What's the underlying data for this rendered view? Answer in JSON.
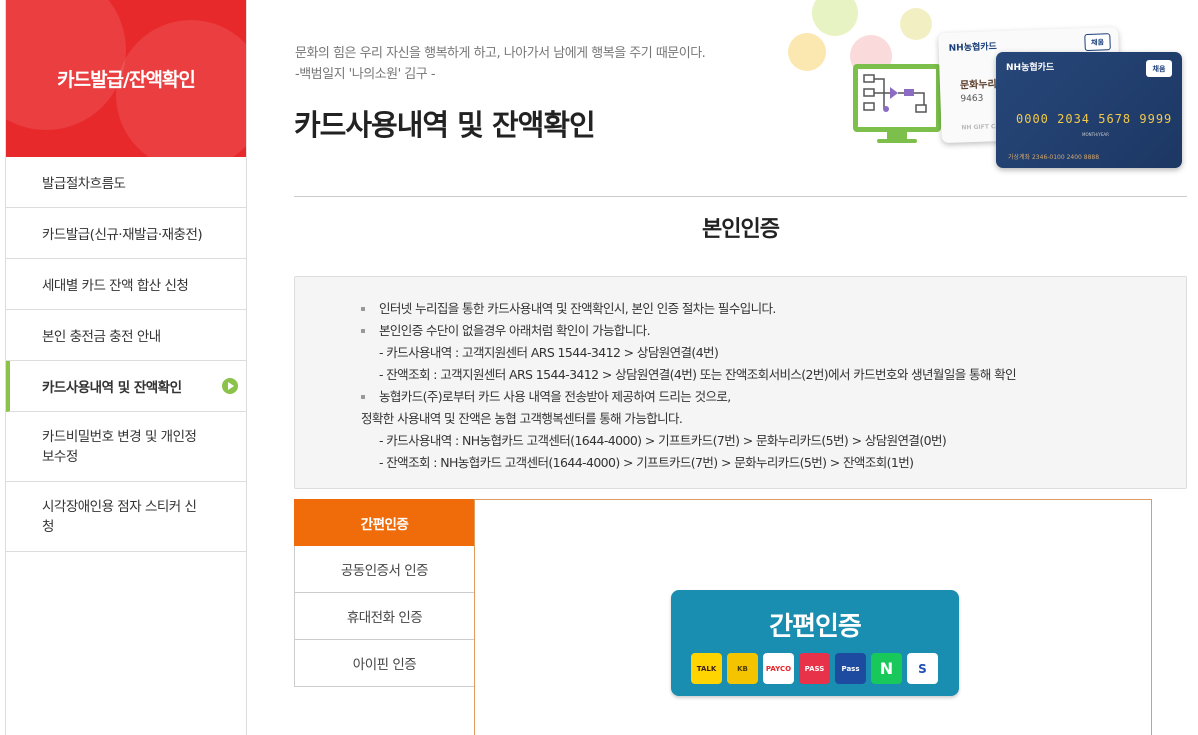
{
  "sidebar": {
    "title": "카드발급/잔액확인",
    "items": [
      {
        "label": "발급절차흐름도"
      },
      {
        "label": "카드발급(신규·재발급·재충전)"
      },
      {
        "label": "세대별 카드 잔액 합산 신청"
      },
      {
        "label": "본인 충전금 충전 안내"
      },
      {
        "label": "카드사용내역 및 잔액확인"
      },
      {
        "label": "카드비밀번호 변경 및 개인정보수정"
      },
      {
        "label": "시각장애인용 점자 스티커 신청"
      }
    ]
  },
  "header": {
    "quote_line1": "문화의 힘은 우리 자신을 행복하게 하고, 나아가서 남에게 행복을 주기 때문이다.",
    "quote_line2": "-백범일지 '나의소원' 김구 -",
    "title": "카드사용내역 및 잔액확인"
  },
  "illustration": {
    "card1_brand": "NH농협카드",
    "card1_badge": "채움",
    "card1_name": "문화누리",
    "card1_num": "9463",
    "card1_bottom": "NH GIFT CA",
    "card2_brand": "NH농협카드",
    "card2_badge": "채움",
    "card2_number": "0000 2034 5678 9999",
    "card2_expiry": "MONTH/YEAR",
    "card2_bottom": "가상계좌  2346-0100 2400 8888"
  },
  "section": {
    "title": "본인인증",
    "info": {
      "b1": "인터넷 누리집을 통한 카드사용내역 및 잔액확인시, 본인 인증 절차는 필수입니다.",
      "b2": "본인인증 수단이 없을경우 아래처럼 확인이 가능합니다.",
      "b2_s1": "- 카드사용내역 : 고객지원센터 ARS 1544-3412 > 상담원연결(4번)",
      "b2_s2": "- 잔액조회 : 고객지원센터 ARS 1544-3412 > 상담원연결(4번) 또는 잔액조회서비스(2번)에서 카드번호와 생년월일을 통해 확인",
      "b3": "농협카드(주)로부터 카드 사용 내역을 전송받아 제공하여 드리는 것으로,",
      "b3_l2": "정확한 사용내역 및 잔액은 농협 고객행복센터를 통해 가능합니다.",
      "b3_s1": "- 카드사용내역 : NH농협카드 고객센터(1644-4000) > 기프트카드(7번) > 문화누리카드(5번) > 상담원연결(0번)",
      "b3_s2": "- 잔액조회 : NH농협카드 고객센터(1644-4000) > 기프트카드(7번) > 문화누리카드(5번) > 잔액조회(1번)"
    }
  },
  "auth": {
    "tabs": [
      {
        "label": "간편인증"
      },
      {
        "label": "공동인증서 인증"
      },
      {
        "label": "휴대전화 인증"
      },
      {
        "label": "아이핀 인증"
      }
    ],
    "easy_title": "간편인증",
    "providers": [
      {
        "icon": "kakao-talk-icon",
        "label": "TALK",
        "color": "#ffd400",
        "text_color": "#3a1d1d"
      },
      {
        "icon": "kb-bank-icon",
        "label": "KB",
        "color": "#f4c400",
        "text_color": "#4a3b00"
      },
      {
        "icon": "payco-icon",
        "label": "PAYCO",
        "color": "#ffffff",
        "text_color": "#e5252a"
      },
      {
        "icon": "pass-icon",
        "label": "PASS",
        "color": "#e8324a",
        "text_color": "#ffffff"
      },
      {
        "icon": "samsung-pass-icon",
        "label": "Pass",
        "color": "#1c4ba0",
        "text_color": "#ffffff"
      },
      {
        "icon": "naver-icon",
        "label": "N",
        "color": "#19c85a",
        "text_color": "#ffffff"
      },
      {
        "icon": "shinhan-bank-icon",
        "label": "S",
        "color": "#ffffff",
        "text_color": "#1f4fb5"
      }
    ]
  },
  "colors": {
    "brand_red": "#e8292b",
    "accent_green": "#8bc34a",
    "tab_orange": "#f06b0a",
    "easy_blue": "#1a8eb0"
  }
}
